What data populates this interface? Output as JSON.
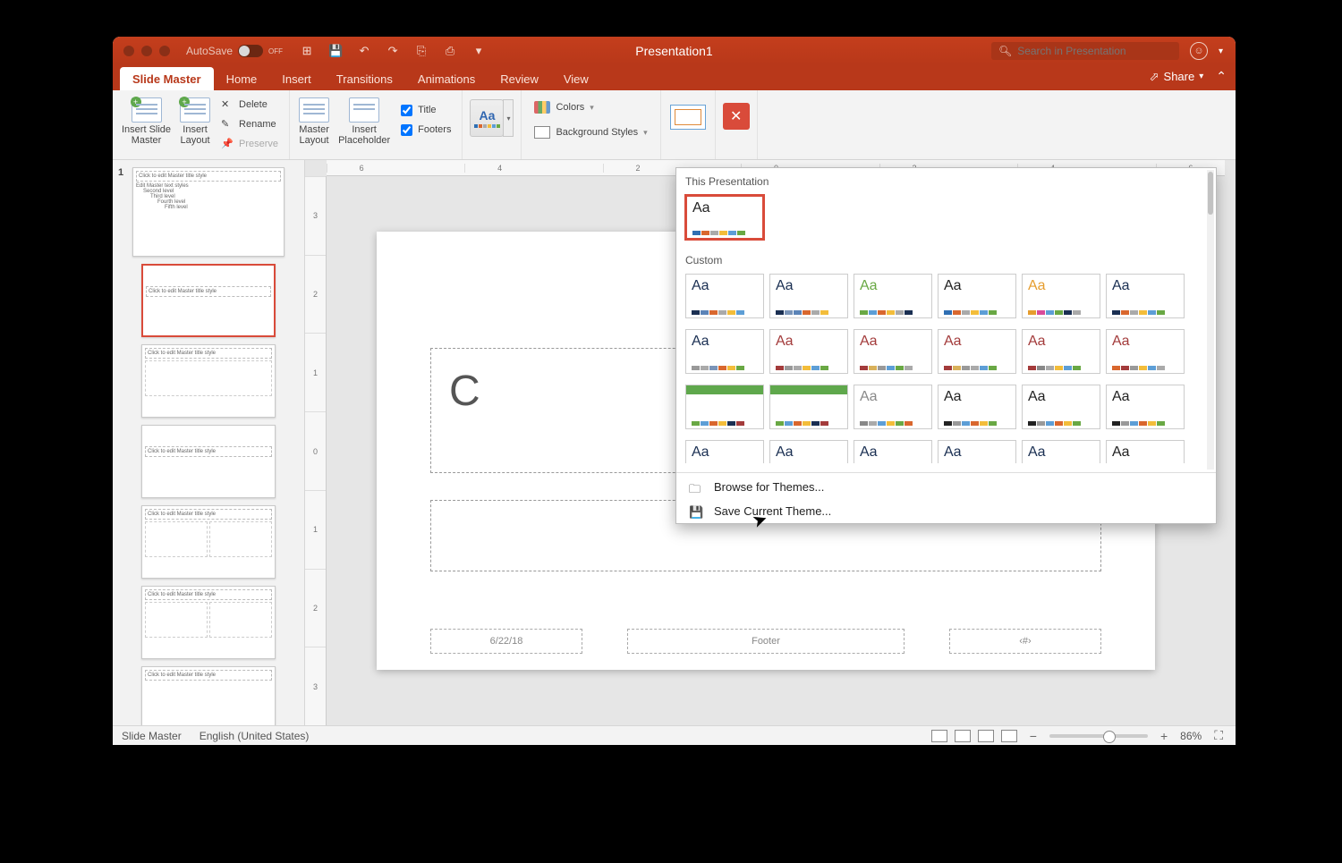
{
  "titlebar": {
    "autosave_label": "AutoSave",
    "autosave_state": "OFF",
    "title": "Presentation1",
    "search_placeholder": "Search in Presentation"
  },
  "tabs": {
    "items": [
      "Slide Master",
      "Home",
      "Insert",
      "Transitions",
      "Animations",
      "Review",
      "View"
    ],
    "active": "Slide Master",
    "share": "Share"
  },
  "ribbon": {
    "insert_slide_master": "Insert Slide\nMaster",
    "insert_layout": "Insert\nLayout",
    "delete": "Delete",
    "rename": "Rename",
    "preserve": "Preserve",
    "master_layout": "Master\nLayout",
    "insert_placeholder": "Insert\nPlaceholder",
    "title_chk": "Title",
    "footers_chk": "Footers",
    "colors": "Colors",
    "bg_styles": "Background Styles"
  },
  "thumbs": {
    "slide_number": "1",
    "master_title": "Click to edit Master title style",
    "bullets": [
      "Edit Master text styles",
      "Second level",
      "Third level",
      "Fourth level",
      "Fifth level"
    ]
  },
  "slide": {
    "title_prefix": "C",
    "date": "6/22/18",
    "footer": "Footer",
    "num": "‹#›"
  },
  "gallery": {
    "sect1": "This Presentation",
    "sect2": "Custom",
    "browse": "Browse for Themes...",
    "save": "Save Current Theme...",
    "themes_current": [
      {
        "aa": "#222",
        "sw": [
          "#2f6fb3",
          "#d9672e",
          "#aaa",
          "#f3bd3a",
          "#5d9ed6",
          "#69a844"
        ]
      }
    ],
    "themes_custom_row1": [
      {
        "aa": "#1a2f52",
        "sw": [
          "#1a2f52",
          "#5b84b8",
          "#d9672e",
          "#aaa",
          "#f3bd3a",
          "#5d9ed6"
        ]
      },
      {
        "aa": "#1a2f52",
        "sw": [
          "#1a2f52",
          "#7a94b8",
          "#5b84b8",
          "#d9672e",
          "#aaa",
          "#f3bd3a"
        ]
      },
      {
        "aa": "#69a844",
        "sw": [
          "#69a844",
          "#5d9ed6",
          "#d9672e",
          "#f3bd3a",
          "#aaa",
          "#1a2f52"
        ]
      },
      {
        "aa": "#222",
        "sw": [
          "#2f6fb3",
          "#d9672e",
          "#aaa",
          "#f3bd3a",
          "#5d9ed6",
          "#69a844"
        ]
      },
      {
        "aa": "#e69d2e",
        "sw": [
          "#e69d2e",
          "#d94b9a",
          "#5d9ed6",
          "#69a844",
          "#1a2f52",
          "#aaa"
        ]
      },
      {
        "aa": "#1a2f52",
        "sw": [
          "#1a2f52",
          "#d9672e",
          "#aaa",
          "#f3bd3a",
          "#5d9ed6",
          "#69a844"
        ]
      }
    ],
    "themes_custom_row2": [
      {
        "aa": "#1a2f52",
        "sw": [
          "#999",
          "#aaa",
          "#7a94b8",
          "#d9672e",
          "#f3bd3a",
          "#69a844"
        ]
      },
      {
        "aa": "#a33b3b",
        "sw": [
          "#a33b3b",
          "#999",
          "#aaa",
          "#f3bd3a",
          "#5d9ed6",
          "#69a844"
        ]
      },
      {
        "aa": "#a33b3b",
        "sw": [
          "#a33b3b",
          "#d9b15a",
          "#999",
          "#5d9ed6",
          "#69a844",
          "#aaa"
        ]
      },
      {
        "aa": "#a33b3b",
        "sw": [
          "#a33b3b",
          "#d9b15a",
          "#999",
          "#aaa",
          "#5d9ed6",
          "#69a844"
        ]
      },
      {
        "aa": "#a33b3b",
        "sw": [
          "#a33b3b",
          "#888",
          "#aaa",
          "#f3bd3a",
          "#5d9ed6",
          "#69a844"
        ]
      },
      {
        "aa": "#a33b3b",
        "sw": [
          "#d9672e",
          "#a33b3b",
          "#999",
          "#f3bd3a",
          "#5d9ed6",
          "#aaa"
        ]
      }
    ],
    "themes_custom_row3": [
      {
        "aa": "",
        "green": true,
        "sw": [
          "#69a844",
          "#5d9ed6",
          "#d9672e",
          "#f3bd3a",
          "#1a2f52",
          "#a33b3b"
        ]
      },
      {
        "aa": "",
        "green": true,
        "sw": [
          "#69a844",
          "#5d9ed6",
          "#d9672e",
          "#f3bd3a",
          "#1a2f52",
          "#a33b3b"
        ]
      },
      {
        "aa": "#888",
        "sw": [
          "#888",
          "#aaa",
          "#5d9ed6",
          "#f3bd3a",
          "#69a844",
          "#d9672e"
        ]
      },
      {
        "aa": "#222",
        "sw": [
          "#222",
          "#999",
          "#5d9ed6",
          "#d9672e",
          "#f3bd3a",
          "#69a844"
        ]
      },
      {
        "aa": "#222",
        "sw": [
          "#222",
          "#999",
          "#5d9ed6",
          "#d9672e",
          "#f3bd3a",
          "#69a844"
        ]
      },
      {
        "aa": "#222",
        "sw": [
          "#222",
          "#999",
          "#5d9ed6",
          "#d9672e",
          "#f3bd3a",
          "#69a844"
        ]
      }
    ],
    "themes_custom_row4": [
      {
        "aa": "#1a2f52"
      },
      {
        "aa": "#1a2f52"
      },
      {
        "aa": "#1a2f52"
      },
      {
        "aa": "#1a2f52"
      },
      {
        "aa": "#1a2f52"
      },
      {
        "aa": "#222"
      }
    ]
  },
  "ruler": {
    "h": [
      "6",
      "",
      "4",
      "",
      "2",
      "",
      "0",
      "",
      "2",
      "",
      "4",
      "",
      "6"
    ],
    "v": [
      "3",
      "2",
      "1",
      "0",
      "1",
      "2",
      "3"
    ]
  },
  "status": {
    "view": "Slide Master",
    "lang": "English (United States)",
    "zoom": "86%"
  }
}
